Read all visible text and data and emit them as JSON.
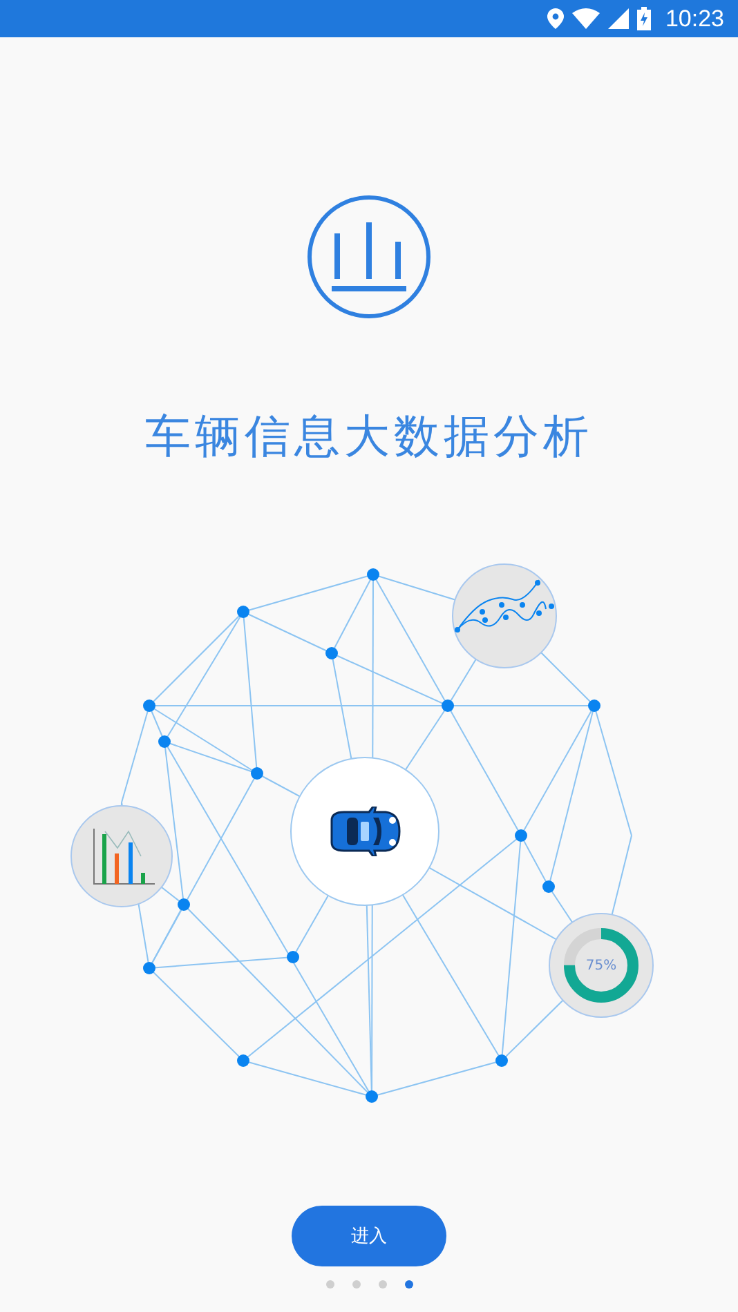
{
  "status_bar": {
    "time": "10:23"
  },
  "title": "车辆信息大数据分析",
  "illustration": {
    "donut": {
      "label": "75%",
      "level": 0.75
    }
  },
  "button": {
    "label": "进入"
  },
  "pager": [
    {
      "selected": false
    },
    {
      "selected": false
    },
    {
      "selected": false
    },
    {
      "selected": true
    }
  ]
}
